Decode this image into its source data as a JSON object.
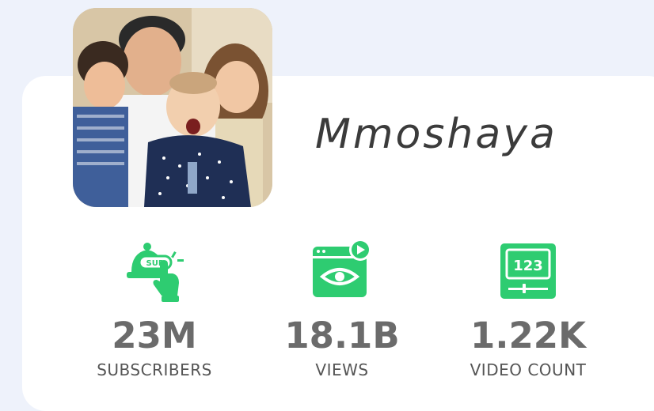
{
  "profile": {
    "name": "Mmoshaya"
  },
  "stats": {
    "subscribers": {
      "value": "23M",
      "label": "SUBSCRIBERS",
      "icon": "subscribe-bell-icon"
    },
    "views": {
      "value": "18.1B",
      "label": "VIEWS",
      "icon": "video-views-icon"
    },
    "videos": {
      "value": "1.22K",
      "label": "VIDEO COUNT",
      "icon": "video-count-icon"
    }
  },
  "colors": {
    "accent": "#2ecc71",
    "background": "#eef2fb",
    "card": "#ffffff",
    "value_text": "#6b6b6b"
  }
}
